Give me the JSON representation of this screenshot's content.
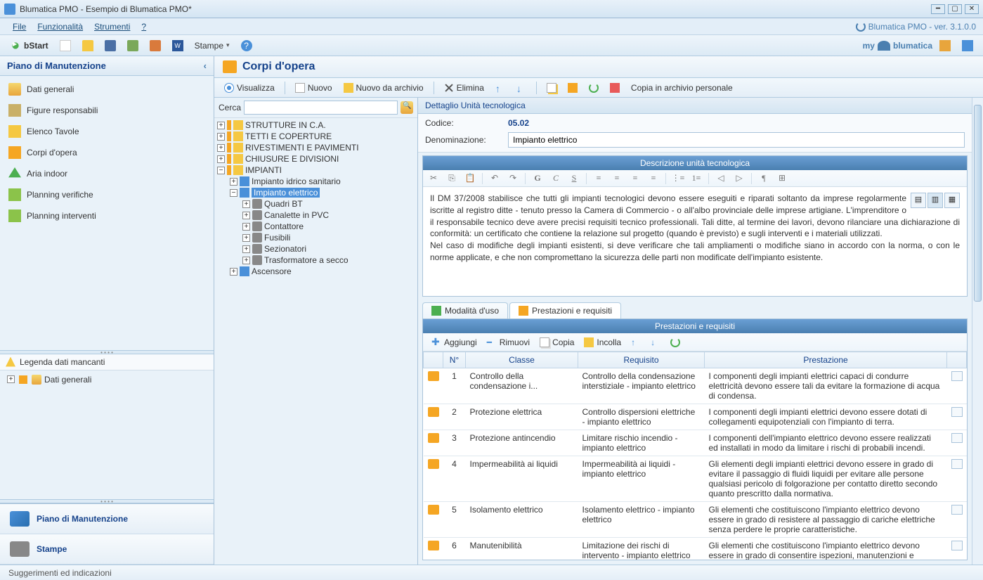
{
  "window": {
    "title": "Blumatica PMO - Esempio di Blumatica PMO*"
  },
  "menubar": {
    "file": "File",
    "funzionalita": "Funzionalità",
    "strumenti": "Strumenti",
    "help": "?",
    "version": "Blumatica PMO - ver. 3.1.0.0"
  },
  "toolbar": {
    "bstart": "bStart",
    "stampe": "Stampe",
    "brand": "myblumatica"
  },
  "leftpanel": {
    "header": "Piano di Manutenzione",
    "nav": {
      "dati": "Dati generali",
      "figure": "Figure responsabili",
      "tavole": "Elenco Tavole",
      "corpi": "Corpi d'opera",
      "aria": "Aria indoor",
      "verifiche": "Planning verifiche",
      "interventi": "Planning interventi"
    },
    "legend": {
      "title": "Legenda dati mancanti",
      "item": "Dati generali"
    },
    "bottom": {
      "piano": "Piano di Manutenzione",
      "stampe": "Stampe"
    }
  },
  "corpi": {
    "title": "Corpi d'opera",
    "subbar": {
      "visualizza": "Visualizza",
      "nuovo": "Nuovo",
      "archivio": "Nuovo da archivio",
      "elimina": "Elimina",
      "copia_archivio": "Copia in archivio personale"
    },
    "search_label": "Cerca",
    "tree": {
      "strutture": "STRUTTURE IN C.A.",
      "tetti": "TETTI E COPERTURE",
      "rivestimenti": "RIVESTIMENTI E PAVIMENTI",
      "chiusure": "CHIUSURE E DIVISIONI",
      "impianti": "IMPIANTI",
      "idrico": "Impianto idrico sanitario",
      "elettrico": "Impianto elettrico",
      "quadri": "Quadri BT",
      "canalette": "Canalette in PVC",
      "contattore": "Contattore",
      "fusibili": "Fusibili",
      "sezionatori": "Sezionatori",
      "trasformatore": "Trasformatore a secco",
      "ascensore": "Ascensore"
    }
  },
  "detail": {
    "header": "Dettaglio Unità tecnologica",
    "codice_label": "Codice:",
    "codice_value": "05.02",
    "denom_label": "Denominazione:",
    "denom_value": "Impianto elettrico",
    "desc_title": "Descrizione unità tecnologica",
    "desc_body": "Il DM 37/2008 stabilisce che tutti gli impianti tecnologici devono essere eseguiti e riparati soltanto da imprese regolarmente iscritte al registro ditte - tenuto presso la Camera di Commercio - o all'albo provinciale delle imprese artigiane. L'imprenditore o il responsabile tecnico deve avere precisi requisiti tecnico professionali. Tali ditte, al termine dei lavori, devono rilanciare una dichiarazione di conformità: un certificato che contiene la relazione sul progetto (quando è previsto) e sugli interventi e i materiali utilizzati.\nNel caso di modifiche degli impianti esistenti, si deve verificare che tali ampliamenti o modifiche siano in accordo con la norma, o con le norme applicate, e che non compromettano la sicurezza delle parti non modificate dell'impianto esistente.",
    "tabs": {
      "modalita": "Modalità d'uso",
      "prestazioni": "Prestazioni e requisiti"
    },
    "prest": {
      "title": "Prestazioni e requisiti",
      "toolbar": {
        "aggiungi": "Aggiungi",
        "rimuovi": "Rimuovi",
        "copia": "Copia",
        "incolla": "Incolla"
      },
      "cols": {
        "num": "N°",
        "classe": "Classe",
        "requisito": "Requisito",
        "prestazione": "Prestazione"
      },
      "rows": [
        {
          "n": "1",
          "classe": "Controllo della condensazione i...",
          "req": "Controllo della condensazione interstiziale - impianto elettrico",
          "prest": "I componenti degli impianti elettrici capaci di condurre elettricità devono essere tali da evitare la formazione di acqua di condensa."
        },
        {
          "n": "2",
          "classe": "Protezione elettrica",
          "req": "Controllo dispersioni elettriche - impianto elettrico",
          "prest": "I componenti degli impianti elettrici devono essere dotati di collegamenti equipotenziali con l'impianto di terra."
        },
        {
          "n": "3",
          "classe": "Protezione antincendio",
          "req": "Limitare rischio incendio - impianto elettrico",
          "prest": "I componenti dell'impianto elettrico devono essere realizzati ed installati in modo da limitare i rischi di probabili incendi."
        },
        {
          "n": "4",
          "classe": "Impermeabilità ai liquidi",
          "req": "Impermeabilità ai liquidi - impianto elettrico",
          "prest": "Gli elementi degli impianti elettrici devono essere in grado di evitare il passaggio di fluidi liquidi per evitare alle persone qualsiasi pericolo di folgorazione per contatto diretto secondo quanto prescritto dalla normativa."
        },
        {
          "n": "5",
          "classe": "Isolamento elettrico",
          "req": "Isolamento elettrico - impianto elettrico",
          "prest": "Gli elementi che costituiscono l'impianto elettrico devono essere in grado di resistere al passaggio di cariche elettriche senza perdere le proprie caratteristiche."
        },
        {
          "n": "6",
          "classe": "Manutenibilità",
          "req": "Limitazione dei rischi di intervento - impianto elettrico",
          "prest": "Gli elementi che costituiscono l'impianto elettrico devono essere in grado di consentire ispezioni, manutenzioni e"
        }
      ]
    }
  },
  "statusbar": "Suggerimenti ed indicazioni"
}
